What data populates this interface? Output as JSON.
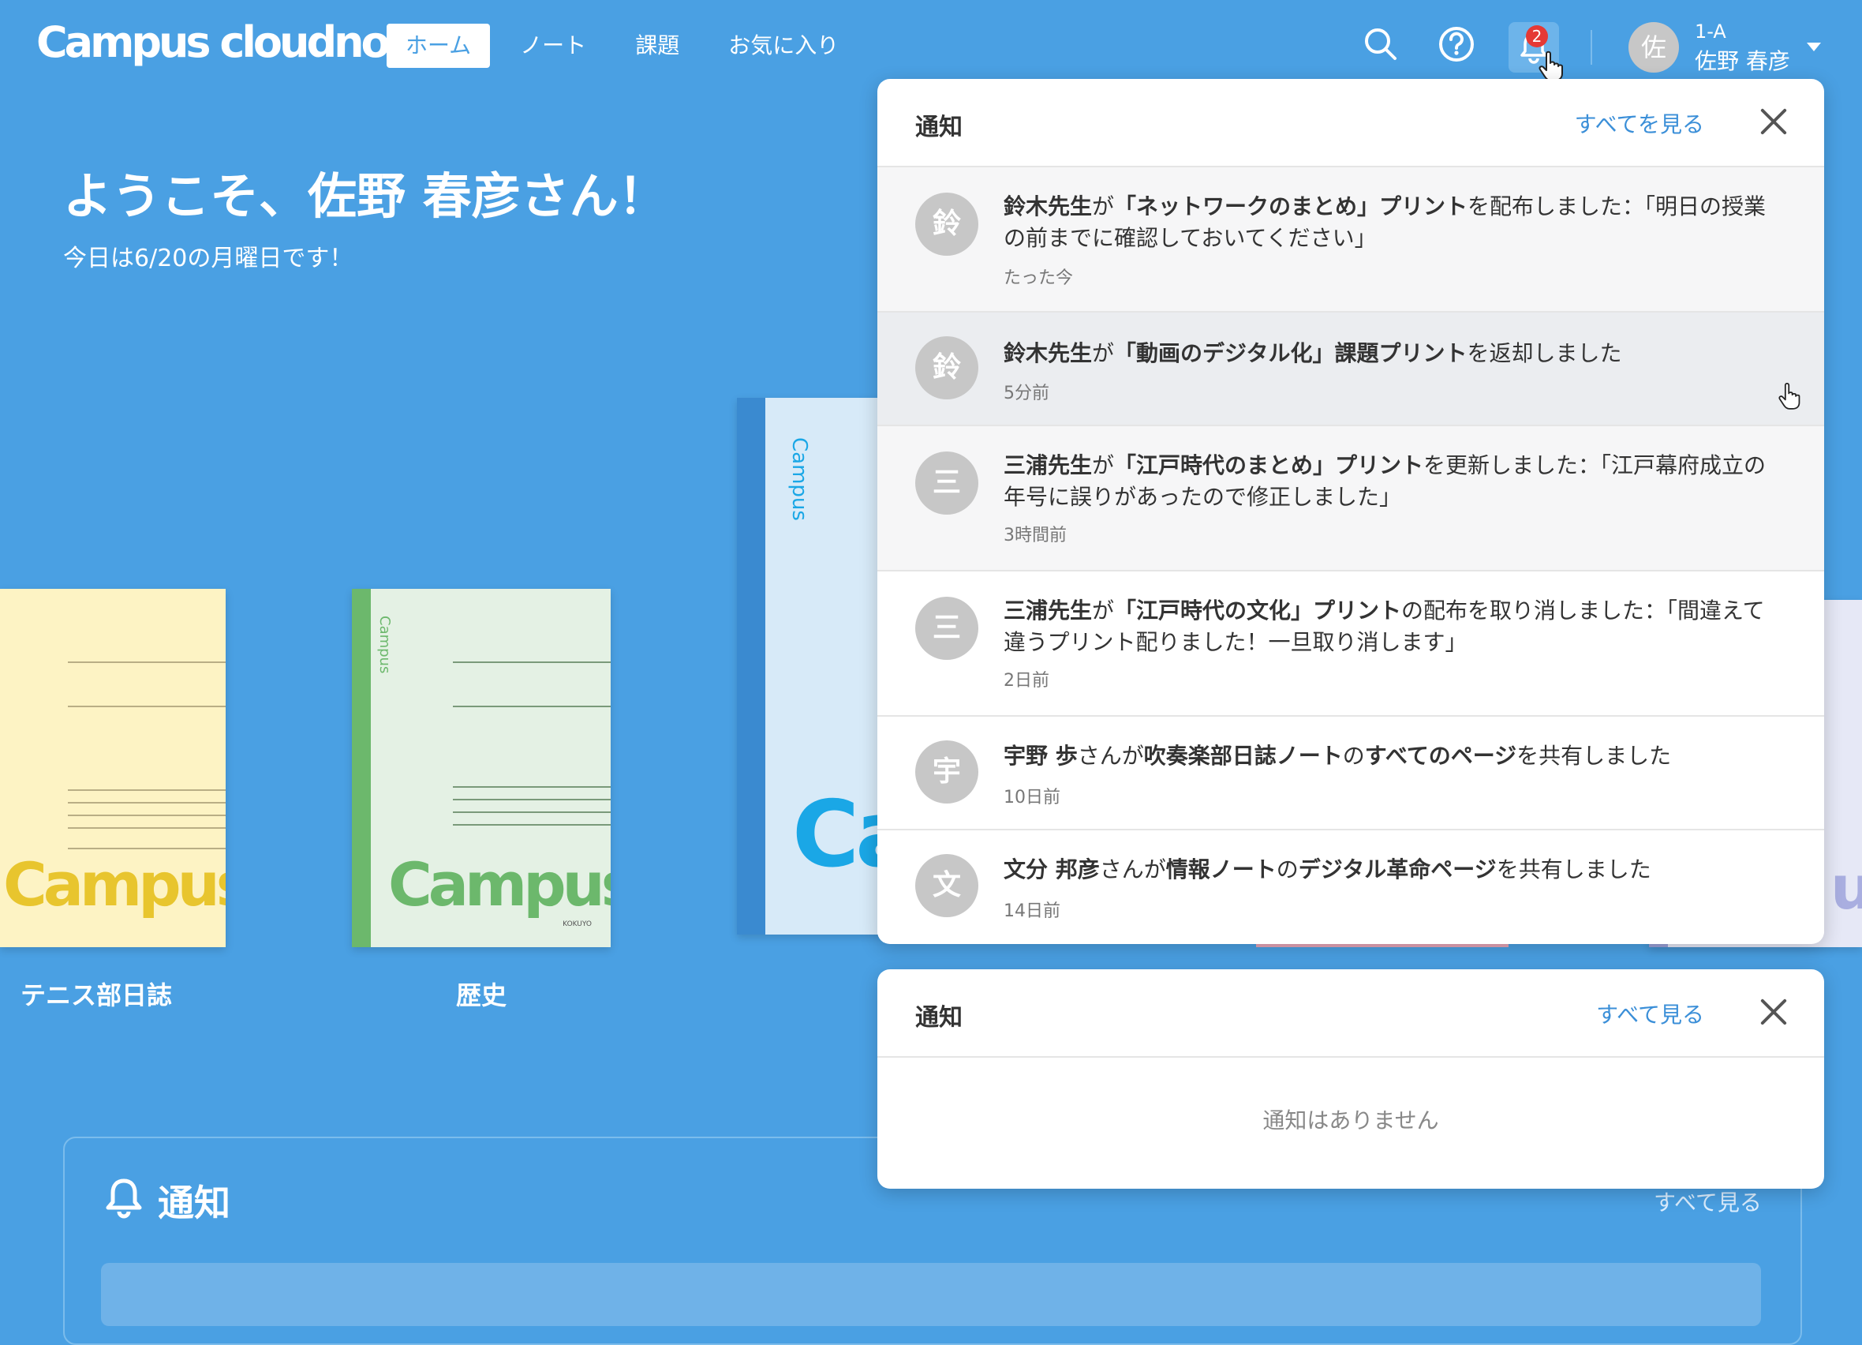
{
  "app": {
    "logo": "Campus cloudnote"
  },
  "nav": {
    "tabs": [
      {
        "label": "ホーム",
        "active": true
      },
      {
        "label": "ノート"
      },
      {
        "label": "課題"
      },
      {
        "label": "お気に入り"
      }
    ]
  },
  "header": {
    "notification_count": "2",
    "user": {
      "avatar": "佐",
      "class": "1-A",
      "name": "佐野 春彦"
    }
  },
  "welcome": {
    "title": "ようこそ、佐野 春彦さん！",
    "date": "今日は6/20の月曜日です！"
  },
  "notebooks": [
    {
      "label": "テニス部日誌",
      "brand": "Campus",
      "color": "#fdf3c4"
    },
    {
      "label": "歴史",
      "brand": "Campus",
      "spine_label": "Campus",
      "color": "#e4f1e4"
    },
    {
      "label": "",
      "brand": "Ca",
      "spine_label": "Campus",
      "color": "#d7eaf8"
    }
  ],
  "notification_panel": {
    "title": "通知",
    "see_all": "すべてを見る",
    "items": [
      {
        "avatar": "鈴",
        "p1": "鈴木先生",
        "p2": "が",
        "p3": "「ネットワークのまとめ」プリント",
        "p4": "を配布しました：「明日の授業の前までに確認しておいてください」",
        "time": "たった今"
      },
      {
        "avatar": "鈴",
        "p1": "鈴木先生",
        "p2": "が",
        "p3": "「動画のデジタル化」課題プリント",
        "p4": "を返却しました",
        "time": "5分前"
      },
      {
        "avatar": "三",
        "p1": "三浦先生",
        "p2": "が",
        "p3": "「江戸時代のまとめ」プリント",
        "p4": "を更新しました：「江戸幕府成立の年号に誤りがあったので修正しました」",
        "time": "3時間前"
      },
      {
        "avatar": "三",
        "p1": "三浦先生",
        "p2": "が",
        "p3": "「江戸時代の文化」プリント",
        "p4": "の配布を取り消しました：「間違えて違うプリント配りました！一旦取り消します」",
        "time": "2日前"
      },
      {
        "avatar": "宇",
        "p1": "宇野 歩",
        "p2": "さんが",
        "p3": "吹奏楽部日誌ノート",
        "p4": "の",
        "p5": "すべてのページ",
        "p6": "を共有しました",
        "time": "10日前"
      },
      {
        "avatar": "文",
        "p1": "文分 邦彦",
        "p2": "さんが",
        "p3": "情報ノート",
        "p4": "の",
        "p5": "デジタル革命ページ",
        "p6": "を共有しました",
        "time": "14日前"
      }
    ]
  },
  "empty_panel": {
    "title": "通知",
    "see_all": "すべて見る",
    "message": "通知はありません"
  },
  "bottom_section": {
    "title": "通知",
    "see_all": "すべて見る"
  }
}
